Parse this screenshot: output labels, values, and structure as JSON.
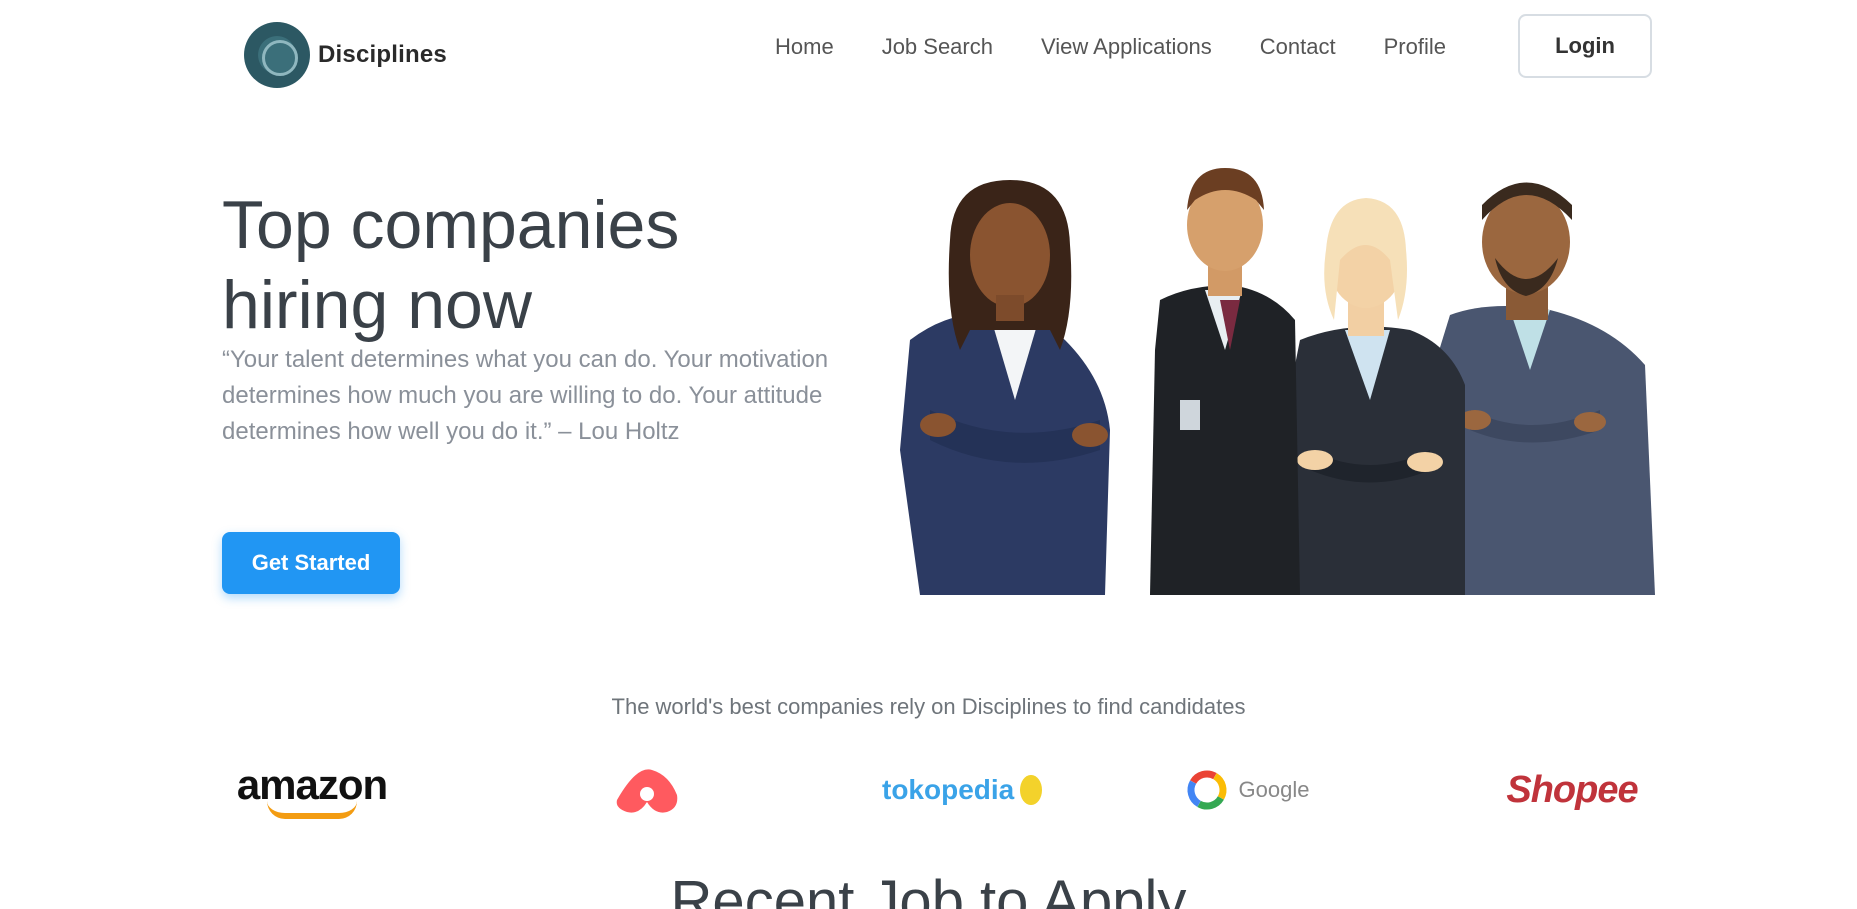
{
  "nav": {
    "brand_name": "Disciplines",
    "links": [
      "Home",
      "Job Search",
      "View Applications",
      "Contact",
      "Profile"
    ],
    "login_label": "Login"
  },
  "hero": {
    "title": "Top companies hiring now",
    "quote": "“Your talent determines what you can do. Your motivation determines how much you are willing to do. Your attitude determines how well you do it.” – Lou Holtz",
    "cta_label": "Get Started"
  },
  "companies": {
    "caption": "The world's best companies rely on Disciplines to find candidates",
    "logos": {
      "amazon": "amazon",
      "tokopedia": "tokopedia",
      "google": "Google",
      "shopee": "Shopee"
    }
  },
  "section": {
    "title": "Recent Job to Apply"
  },
  "colors": {
    "primary": "#2196f3",
    "heading": "#3a4148",
    "muted": "#8a9099",
    "amazon_orange": "#f39c12",
    "airbnb_red": "#ff5a5f",
    "shopee_red": "#c0333b"
  }
}
